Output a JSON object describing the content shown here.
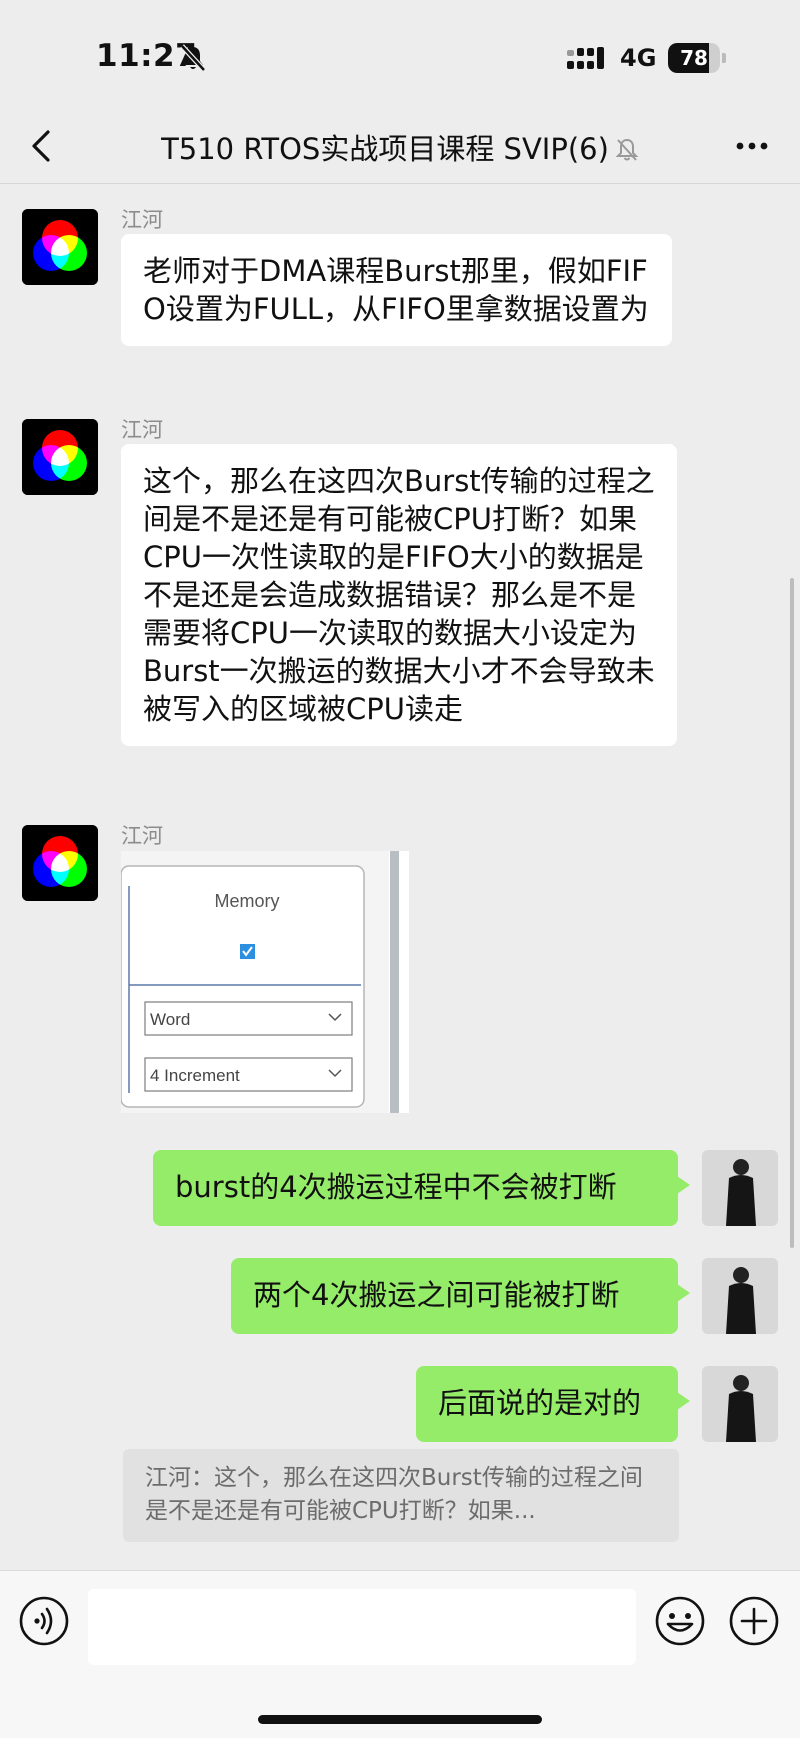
{
  "status": {
    "time": "11:27",
    "network": "4G",
    "battery": "78",
    "battery_level": 0.78
  },
  "nav": {
    "title": "T510 RTOS实战项目课程 SVIP(6)"
  },
  "messages": [
    {
      "sender": "江河",
      "text": "老师对于DMA课程Burst那里，假如FIFO设置为FULL，从FIFO里拿数据设置为"
    },
    {
      "sender": "江河",
      "text": "这个，那么在这四次Burst传输的过程之间是不是还是有可能被CPU打断？如果CPU一次性读取的是FIFO大小的数据是不是还是会造成数据错误？那么是不是需要将CPU一次读取的数据大小设定为Burst一次搬运的数据大小才不会导致未被写入的区域被CPU读走"
    },
    {
      "sender": "江河",
      "image": {
        "header": "Memory",
        "checked": true,
        "select_width": "Word",
        "select_increment": "4 Increment"
      }
    },
    {
      "self": true,
      "text": "burst的4次搬运过程中不会被打断"
    },
    {
      "self": true,
      "text": "两个4次搬运之间可能被打断"
    },
    {
      "self": true,
      "text": "后面说的是对的"
    }
  ],
  "quote": {
    "text": "江河：这个，那么在这四次Burst传输的过程之间是不是还是有可能被CPU打断？如果..."
  },
  "input": {
    "value": "",
    "placeholder": ""
  },
  "icons": {
    "back": "chevron-left-icon",
    "mute": "bell-off-icon",
    "more": "more-icon",
    "voice": "voice-icon",
    "emoji": "emoji-icon",
    "plus": "plus-icon"
  }
}
